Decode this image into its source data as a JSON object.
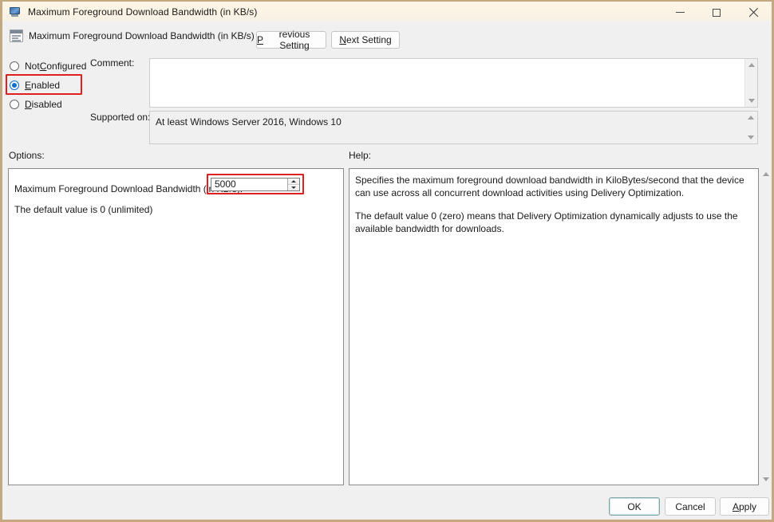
{
  "window": {
    "title": "Maximum Foreground Download Bandwidth (in KB/s)",
    "title_icon": "policy-setting-window-icon",
    "caption": {
      "minimize": "minimize-icon",
      "maximize": "maximize-icon",
      "close": "close-icon"
    },
    "accent_color": "#0b6ec9",
    "highlight_color": "#e02020",
    "titlebar_color": "#fbf3e4",
    "border_color": "#c4a882"
  },
  "header": {
    "setting_icon": "policy-setting-icon",
    "setting_title": "Maximum Foreground Download Bandwidth (in KB/s)",
    "previous_button": {
      "accel": "P",
      "rest": "revious Setting"
    },
    "next_button": {
      "accel": "N",
      "rest": "ext Setting"
    }
  },
  "state": {
    "radios": [
      {
        "name": "not-configured",
        "accel_prefix": "Not ",
        "accel": "C",
        "rest": "onfigured",
        "selected": false
      },
      {
        "name": "enabled",
        "accel_prefix": "",
        "accel": "E",
        "rest": "nabled",
        "selected": true
      },
      {
        "name": "disabled",
        "accel_prefix": "",
        "accel": "D",
        "rest": "isabled",
        "selected": false
      }
    ],
    "selected_value": "Enabled",
    "comment_label": "Comment:",
    "comment_value": "",
    "supported_label": "Supported on:",
    "supported_value": "At least Windows Server 2016, Windows 10"
  },
  "options": {
    "section_label": "Options:",
    "setting_label": "Maximum Foreground Download Bandwidth (in KB/s):",
    "default_note": "The default value is 0 (unlimited)",
    "spinner_value": "5000",
    "spinner_up_icon": "spinner-up-icon",
    "spinner_down_icon": "spinner-down-icon"
  },
  "help": {
    "section_label": "Help:",
    "paragraphs": [
      "Specifies the maximum foreground download bandwidth in KiloBytes/second that the device can use across all concurrent download activities using Delivery Optimization.",
      "The default value 0 (zero) means that Delivery Optimization dynamically adjusts to use the available bandwidth for downloads."
    ],
    "paragraph_1": "Specifies the maximum foreground download bandwidth in KiloBytes/second that the device can use across all concurrent download activities using Delivery Optimization.",
    "paragraph_2": "The default value 0 (zero) means that Delivery Optimization dynamically adjusts to use the available bandwidth for downloads."
  },
  "footer": {
    "ok_label": "OK",
    "cancel_label": "Cancel",
    "apply": {
      "accel": "A",
      "rest": "pply"
    }
  },
  "scrollbars": {
    "up_icon": "scroll-up-arrow-icon",
    "down_icon": "scroll-down-arrow-icon"
  }
}
